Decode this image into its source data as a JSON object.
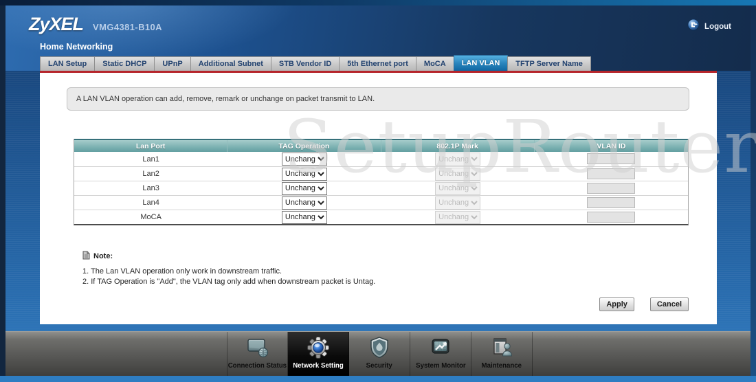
{
  "header": {
    "brand": "ZyXEL",
    "model": "VMG4381-B10A",
    "logout": "Logout",
    "section_title": "Home Networking"
  },
  "tabs": [
    {
      "label": "LAN Setup",
      "active": false
    },
    {
      "label": "Static DHCP",
      "active": false
    },
    {
      "label": "UPnP",
      "active": false
    },
    {
      "label": "Additional Subnet",
      "active": false
    },
    {
      "label": "STB Vendor ID",
      "active": false
    },
    {
      "label": "5th Ethernet port",
      "active": false
    },
    {
      "label": "MoCA",
      "active": false
    },
    {
      "label": "LAN VLAN",
      "active": true
    },
    {
      "label": "TFTP Server Name",
      "active": false
    }
  ],
  "info_text": "A LAN VLAN operation can add, remove, remark or unchange on packet transmit to LAN.",
  "table": {
    "headers": [
      "Lan Port",
      "TAG Operation",
      "802.1P Mark",
      "VLAN ID"
    ],
    "rows": [
      {
        "port": "Lan1",
        "tag_operation": "Unchange",
        "p8021_mark": "Unchange",
        "vlan_id": ""
      },
      {
        "port": "Lan2",
        "tag_operation": "Unchange",
        "p8021_mark": "Unchange",
        "vlan_id": ""
      },
      {
        "port": "Lan3",
        "tag_operation": "Unchange",
        "p8021_mark": "Unchange",
        "vlan_id": ""
      },
      {
        "port": "Lan4",
        "tag_operation": "Unchange",
        "p8021_mark": "Unchange",
        "vlan_id": ""
      },
      {
        "port": "MoCA",
        "tag_operation": "Unchange",
        "p8021_mark": "Unchange",
        "vlan_id": ""
      }
    ]
  },
  "note": {
    "title": "Note:",
    "items": [
      "1. The Lan VLAN operation only work in downstream traffic.",
      "2. If TAG Operation is \"Add\", the VLAN tag only add when downstream packet is Untag."
    ]
  },
  "buttons": {
    "apply": "Apply",
    "cancel": "Cancel"
  },
  "navbar": [
    {
      "label": "Connection Status",
      "active": false
    },
    {
      "label": "Network Setting",
      "active": true
    },
    {
      "label": "Security",
      "active": false
    },
    {
      "label": "System Monitor",
      "active": false
    },
    {
      "label": "Maintenance",
      "active": false
    }
  ],
  "watermark": "SetupRouter.co",
  "colors": {
    "accent_red": "#b6252b",
    "tab_active_blue": "#1472ab",
    "table_header_teal": "#6aa3a5",
    "bottom_strip_blue": "#2e7dc2"
  }
}
